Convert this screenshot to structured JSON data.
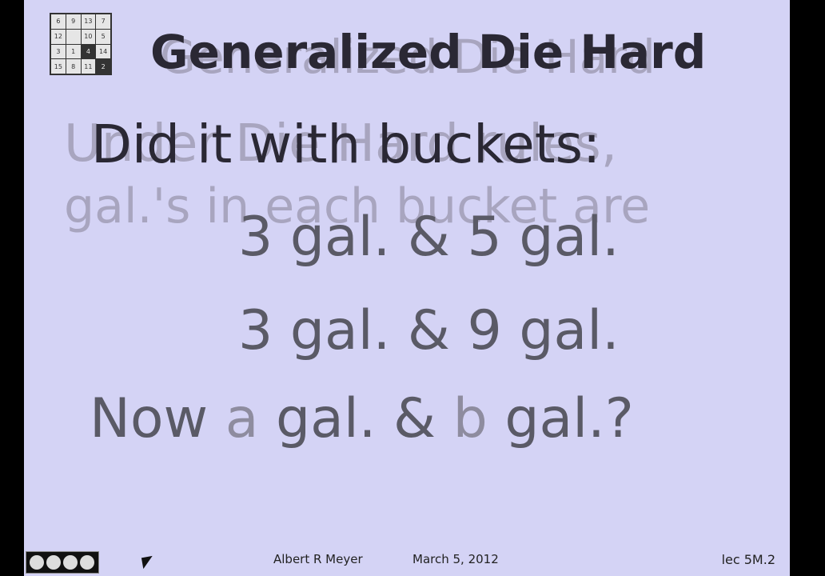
{
  "slide": {
    "title_ghost": "Generalized Die Hard",
    "title": "Generalized Die Hard",
    "under_ghost": "Under Die Hard rules,",
    "did_it": "Did it with buckets:",
    "galls_ghost": "gal.'s in each bucket are",
    "line1": "3 gal. & 5 gal.",
    "line2": "3 gal. & 9 gal.",
    "line3_prefix": "Now ",
    "line3_a": "a",
    "line3_mid": " gal. & ",
    "line3_b": "b",
    "line3_suffix": " gal.?"
  },
  "logo": {
    "cells": [
      "6",
      "9",
      "13",
      "7",
      "12",
      "",
      "10",
      "5",
      "3",
      "1",
      "4",
      "14",
      "15",
      "8",
      "11",
      "2"
    ]
  },
  "footer": {
    "author": "Albert R Meyer",
    "date": "March 5, 2012",
    "lecture": "lec 5M.2"
  }
}
